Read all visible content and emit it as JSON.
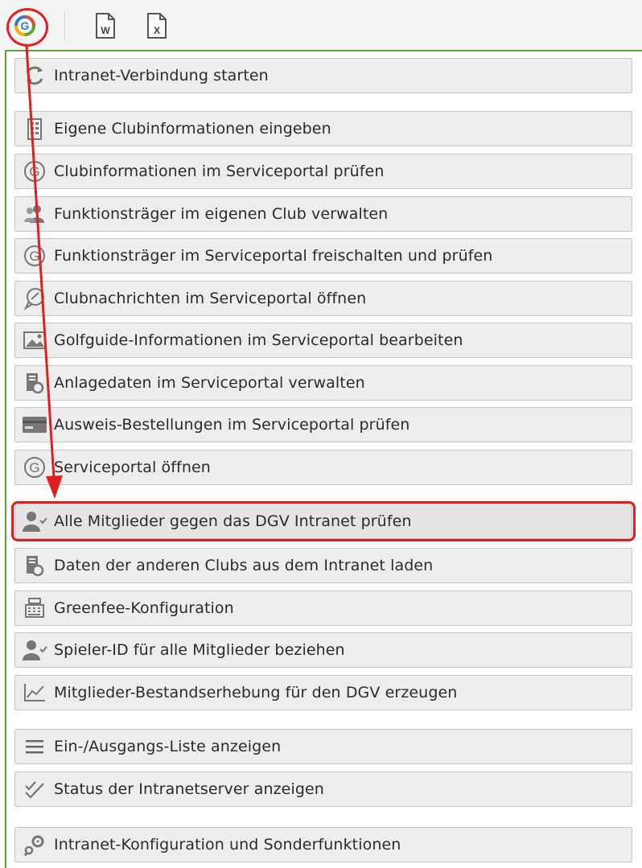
{
  "toolbar": {
    "buttons": [
      {
        "icon": "golf-g-icon"
      },
      {
        "icon": "word-document-icon"
      },
      {
        "icon": "excel-document-icon"
      }
    ]
  },
  "menu": {
    "items": [
      {
        "label": "Intranet-Verbindung starten",
        "icon": "refresh-icon"
      },
      {
        "label": "Eigene Clubinformationen eingeben",
        "icon": "building-icon"
      },
      {
        "label": "Clubinformationen im Serviceportal prüfen",
        "icon": "g-circle-icon"
      },
      {
        "label": "Funktionsträger im eigenen Club verwalten",
        "icon": "people-icon"
      },
      {
        "label": "Funktionsträger im Serviceportal freischalten und prüfen",
        "icon": "g-circle-icon"
      },
      {
        "label": "Clubnachrichten im Serviceportal öffnen",
        "icon": "chat-bubble-icon"
      },
      {
        "label": "Golfguide-Informationen im Serviceportal bearbeiten",
        "icon": "image-icon"
      },
      {
        "label": "Anlagedaten im Serviceportal verwalten",
        "icon": "server-icon"
      },
      {
        "label": "Ausweis-Bestellungen im Serviceportal prüfen",
        "icon": "card-icon"
      },
      {
        "label": "Serviceportal öffnen",
        "icon": "g-circle-icon"
      },
      {
        "label": "Alle Mitglieder gegen das DGV Intranet prüfen",
        "icon": "user-check-icon"
      },
      {
        "label": "Daten der anderen Clubs aus dem Intranet laden",
        "icon": "server-icon"
      },
      {
        "label": "Greenfee-Konfiguration",
        "icon": "cash-register-icon"
      },
      {
        "label": "Spieler-ID für alle Mitglieder beziehen",
        "icon": "user-check-icon"
      },
      {
        "label": "Mitglieder-Bestandserhebung für den DGV erzeugen",
        "icon": "line-chart-icon"
      },
      {
        "label": "Ein-/Ausgangs-Liste anzeigen",
        "icon": "list-icon"
      },
      {
        "label": "Status der Intranetserver anzeigen",
        "icon": "double-check-icon"
      },
      {
        "label": "Intranet-Konfiguration und Sonderfunktionen",
        "icon": "gears-icon"
      }
    ]
  },
  "colors": {
    "highlight": "#e02020",
    "panel_border": "#5aa634"
  }
}
